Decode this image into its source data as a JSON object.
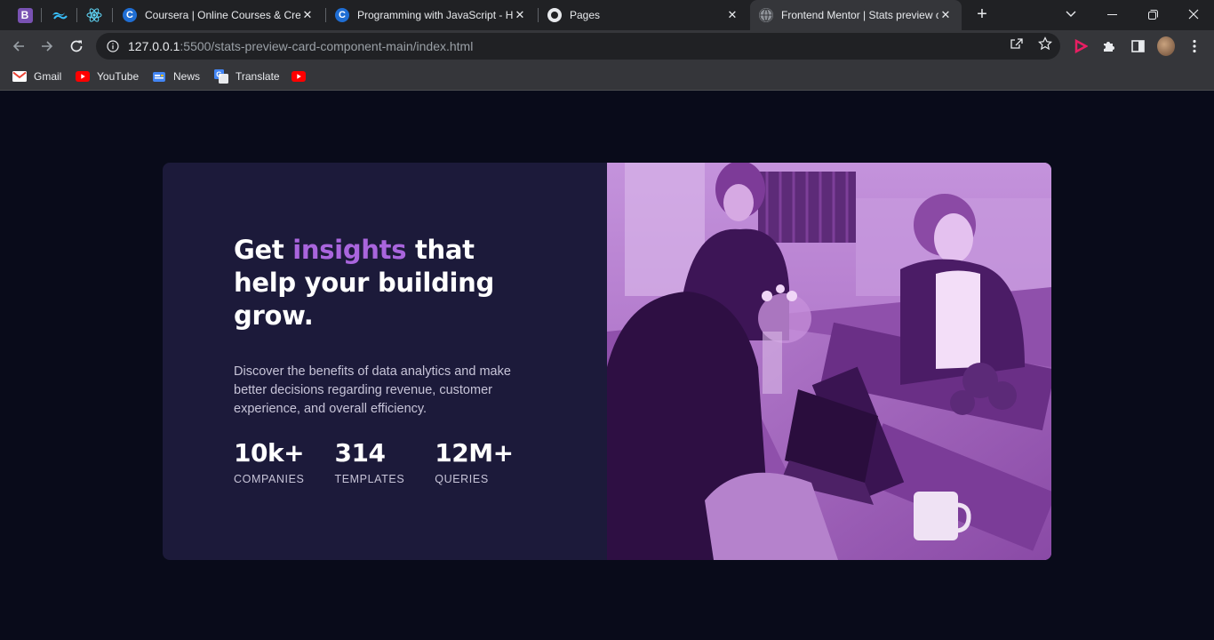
{
  "browser": {
    "pinned_tabs": [
      {
        "icon": "bootstrap-icon",
        "glyph": "B",
        "color": "#7952b3"
      },
      {
        "icon": "tailwind-icon",
        "color": "#38bdf8"
      },
      {
        "icon": "react-icon",
        "color": "#61dafb"
      }
    ],
    "tabs": [
      {
        "title": "Coursera | Online Courses & Credentials",
        "icon": "coursera-icon",
        "active": false
      },
      {
        "title": "Programming with JavaScript - Home",
        "icon": "coursera-icon",
        "active": false
      },
      {
        "title": "Pages",
        "icon": "github-icon",
        "active": false
      },
      {
        "title": "Frontend Mentor | Stats preview card component",
        "icon": "globe-icon",
        "active": true
      }
    ],
    "url_host": "127.0.0.1",
    "url_path": ":5500/stats-preview-card-component-main/index.html",
    "bookmarks": [
      {
        "label": "Gmail",
        "icon": "gmail-icon"
      },
      {
        "label": "YouTube",
        "icon": "youtube-icon"
      },
      {
        "label": "News",
        "icon": "news-icon"
      },
      {
        "label": "Translate",
        "icon": "translate-icon"
      },
      {
        "label": "",
        "icon": "youtube-icon"
      }
    ]
  },
  "card": {
    "headline_before": "Get ",
    "headline_accent": "insights",
    "headline_after": " that help your building grow.",
    "description": "Discover the benefits of data analytics and make better decisions regarding revenue, customer experience, and overall efficiency.",
    "stats": [
      {
        "value": "10k+",
        "label": "COMPANIES"
      },
      {
        "value": "314",
        "label": "TEMPLATES"
      },
      {
        "value": "12M+",
        "label": "QUERIES"
      }
    ]
  },
  "colors": {
    "page_bg": "#090b1a",
    "card_bg": "#1c1a3a",
    "accent": "#a965dd",
    "photo_tint": "#9a55b3"
  }
}
